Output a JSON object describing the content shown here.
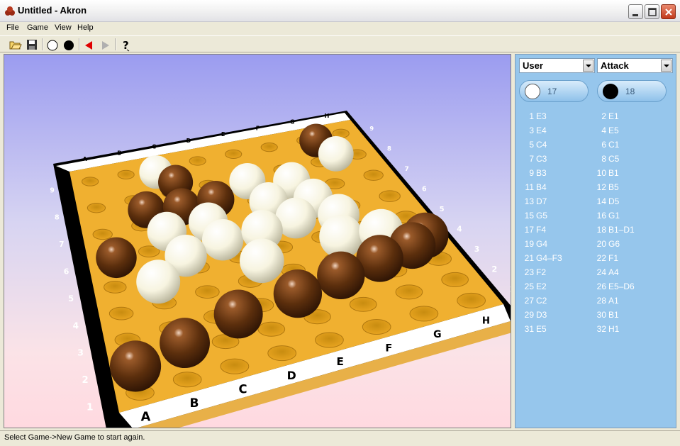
{
  "window": {
    "title": "Untitled - Akron"
  },
  "menu": {
    "file": "File",
    "game": "Game",
    "view": "View",
    "help": "Help"
  },
  "toolbar": [
    "open-icon",
    "save-icon",
    "white-piece-icon",
    "black-piece-icon",
    "undo-arrow-icon",
    "redo-arrow-icon",
    "help-icon"
  ],
  "board": {
    "columns": [
      "A",
      "B",
      "C",
      "D",
      "E",
      "F",
      "G",
      "H"
    ],
    "rows": [
      "1",
      "2",
      "3",
      "4",
      "5",
      "6",
      "7",
      "8",
      "9"
    ],
    "colors": {
      "board": "#f0b030",
      "border": "#000000",
      "white_ball": "#fffde8",
      "black_ball": "#5a2e0c"
    }
  },
  "panel": {
    "player_mode": "User",
    "strategy": "Attack",
    "white_score": "17",
    "black_score": "18",
    "moves": [
      {
        "n": "1",
        "m": "E3"
      },
      {
        "n": "2",
        "m": "E1"
      },
      {
        "n": "3",
        "m": "E4"
      },
      {
        "n": "4",
        "m": "E5"
      },
      {
        "n": "5",
        "m": "C4"
      },
      {
        "n": "6",
        "m": "C1"
      },
      {
        "n": "7",
        "m": "C3"
      },
      {
        "n": "8",
        "m": "C5"
      },
      {
        "n": "9",
        "m": "B3"
      },
      {
        "n": "10",
        "m": "B1"
      },
      {
        "n": "11",
        "m": "B4"
      },
      {
        "n": "12",
        "m": "B5"
      },
      {
        "n": "13",
        "m": "D7"
      },
      {
        "n": "14",
        "m": "D5"
      },
      {
        "n": "15",
        "m": "G5"
      },
      {
        "n": "16",
        "m": "G1"
      },
      {
        "n": "17",
        "m": "F4"
      },
      {
        "n": "18",
        "m": "B1–D1"
      },
      {
        "n": "19",
        "m": "G4"
      },
      {
        "n": "20",
        "m": "G6"
      },
      {
        "n": "21",
        "m": "G4–F3"
      },
      {
        "n": "22",
        "m": "F1"
      },
      {
        "n": "23",
        "m": "F2"
      },
      {
        "n": "24",
        "m": "A4"
      },
      {
        "n": "25",
        "m": "E2"
      },
      {
        "n": "26",
        "m": "E5–D6"
      },
      {
        "n": "27",
        "m": "C2"
      },
      {
        "n": "28",
        "m": "A1"
      },
      {
        "n": "29",
        "m": "D3"
      },
      {
        "n": "30",
        "m": "B1"
      },
      {
        "n": "31",
        "m": "E5"
      },
      {
        "n": "32",
        "m": "H1"
      }
    ]
  },
  "status": {
    "text": "Select Game->New Game to start again."
  }
}
